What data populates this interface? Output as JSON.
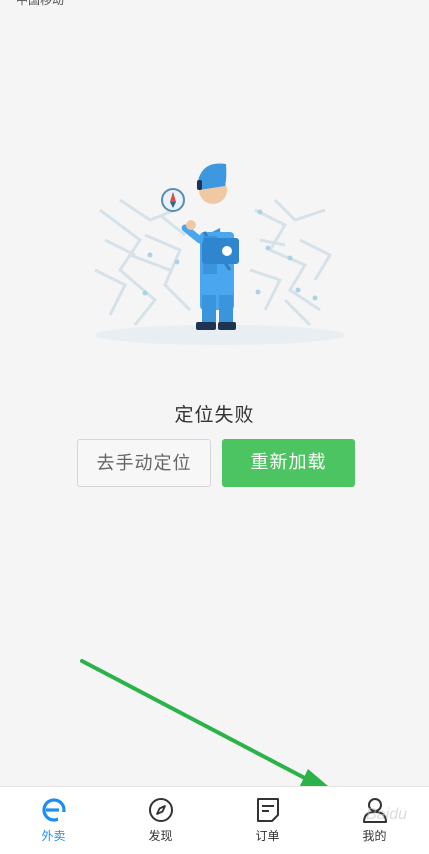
{
  "status_bar": {
    "carrier": "中国移动"
  },
  "main": {
    "title": "定位失败",
    "manual_button": "去手动定位",
    "reload_button": "重新加载"
  },
  "tabbar": {
    "tabs": [
      {
        "label": "外卖",
        "icon": "eleme-logo-icon",
        "active": true
      },
      {
        "label": "发现",
        "icon": "compass-icon",
        "active": false
      },
      {
        "label": "订单",
        "icon": "order-document-icon",
        "active": false
      },
      {
        "label": "我的",
        "icon": "user-profile-icon",
        "active": false
      }
    ]
  },
  "colors": {
    "accent_blue": "#1a8ef5",
    "reload_green": "#4cc462",
    "annotation_arrow": "#2bb34a"
  }
}
